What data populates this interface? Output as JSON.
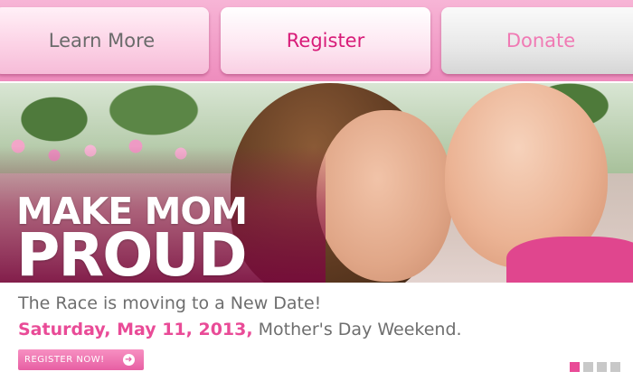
{
  "nav": {
    "learn_more": "Learn More",
    "register": "Register",
    "donate": "Donate"
  },
  "hero": {
    "title_line1": "MAKE MOM",
    "title_line2": "PROUD"
  },
  "announcement": {
    "line1": "The Race is moving to a New Date!",
    "date": "Saturday, May 11, 2013,",
    "line2_rest": " Mother's Day Weekend."
  },
  "cta": {
    "label": "REGISTER NOW!",
    "icon": "arrow-right-icon"
  },
  "carousel": {
    "slide_count": 4,
    "active_index": 0
  },
  "colors": {
    "brand_pink": "#e94b97",
    "nav_strip": "#ee8cbd",
    "text_gray": "#6e6e6e"
  }
}
